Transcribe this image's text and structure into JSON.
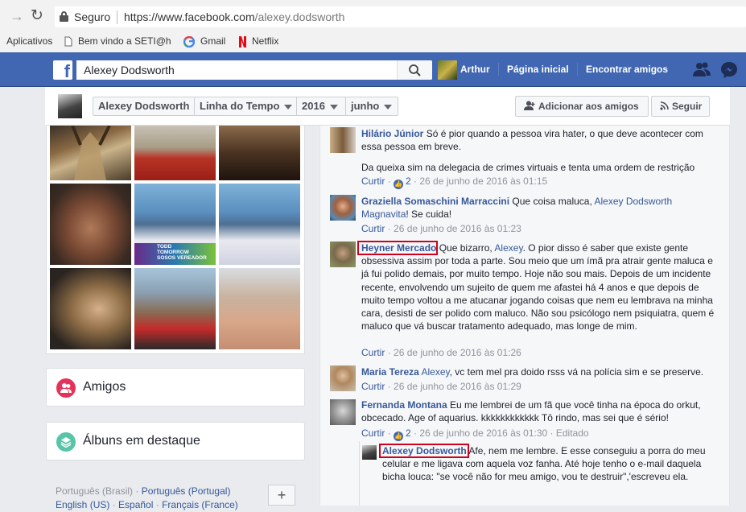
{
  "browser": {
    "secure_label": "Seguro",
    "url_host": "https://www.facebook.com",
    "url_path": "/alexey.dodsworth",
    "bookmarks": [
      "Aplicativos",
      "Bem vindo a SETI@h",
      "Gmail",
      "Netflix"
    ]
  },
  "fb": {
    "search_value": "Alexey Dodsworth",
    "user_name": "Arthur",
    "nav_home": "Página inicial",
    "nav_find_friends": "Encontrar amigos"
  },
  "timeline": {
    "name": "Alexey Dodsworth",
    "section": "Linha do Tempo",
    "year": "2016",
    "month": "junho",
    "add_friend": "Adicionar aos amigos",
    "follow": "Seguir"
  },
  "left": {
    "friends_title": "Amigos",
    "albums_title": "Álbuns em destaque",
    "photo_overlay_lines": [
      "TODD",
      "TOMORROW",
      "SOSOS",
      "VEREADOR"
    ],
    "langs_line1_current": "Português (Brasil)",
    "langs_line1_link": "Português (Portugal)",
    "langs_line2": [
      "English (US)",
      "Español",
      "Français (France)"
    ],
    "langs_plus": "+"
  },
  "comments": [
    {
      "author": "Hilário Júnior",
      "text": "Só é pior quando a pessoa vira hater, o que deve acontecer com essa pessoa em breve.",
      "text2": "Da queixa sim na delegacia de crimes virtuais e tenta uma ordem de restrição",
      "like": "Curtir",
      "likes": "2",
      "time": "26 de junho de 2016 às 01:15"
    },
    {
      "author": "Graziella Somaschini Marraccini",
      "text_pre": "Que coisa maluca,",
      "mention1": "Alexey Dodsworth",
      "mention2": "Magnavita",
      "text_post": "! Se cuida!",
      "like": "Curtir",
      "time": "26 de junho de 2016 às 01:23"
    },
    {
      "author": "Heyner Mercado",
      "text_pre": "Que bizarro,",
      "mention": "Alexey",
      "text_post": ". O pior disso é saber que existe gente obsessiva assim por toda a parte. Sou meio que um ímã pra atrair gente maluca e já fui polido demais, por muito tempo. Hoje não sou mais. Depois de um incidente recente, envolvendo um sujeito de quem me afastei há 4 anos e que depois de muito tempo voltou a me atucanar jogando coisas que nem eu lembrava na minha cara, desisti de ser polido com maluco. Não sou psicólogo nem psiquiatra, quem é maluco que vá buscar tratamento adequado, mas longe de mim.",
      "like": "Curtir",
      "time": "26 de junho de 2016 às 01:26"
    },
    {
      "author": "Maria Tereza",
      "mention": "Alexey",
      "text_post": ", vc tem mel pra doido rsss vá na polícia sim e se preserve.",
      "like": "Curtir",
      "time": "26 de junho de 2016 às 01:29"
    },
    {
      "author": "Fernanda Montana",
      "text": "Eu me lembrei de um fã que você tinha na época do orkut, obcecado. Age of aquarius. kkkkkkkkkkkk Tô rindo, mas sei que é sério!",
      "like": "Curtir",
      "likes": "2",
      "time": "26 de junho de 2016 às 01:30",
      "edited": "Editado"
    },
    {
      "author": "Alexey Dodsworth",
      "text": "Afe, nem me lembre. E esse conseguiu a porra do meu celular e me ligava com aquela voz fanha. Até hoje tenho o e-mail daquela bicha louca: \"se você não for meu amigo, vou te destruir\",'escreveu ela."
    }
  ],
  "colors": {
    "fb_blue": "#4267b2",
    "link": "#365899",
    "highlight": "#d0021b"
  }
}
